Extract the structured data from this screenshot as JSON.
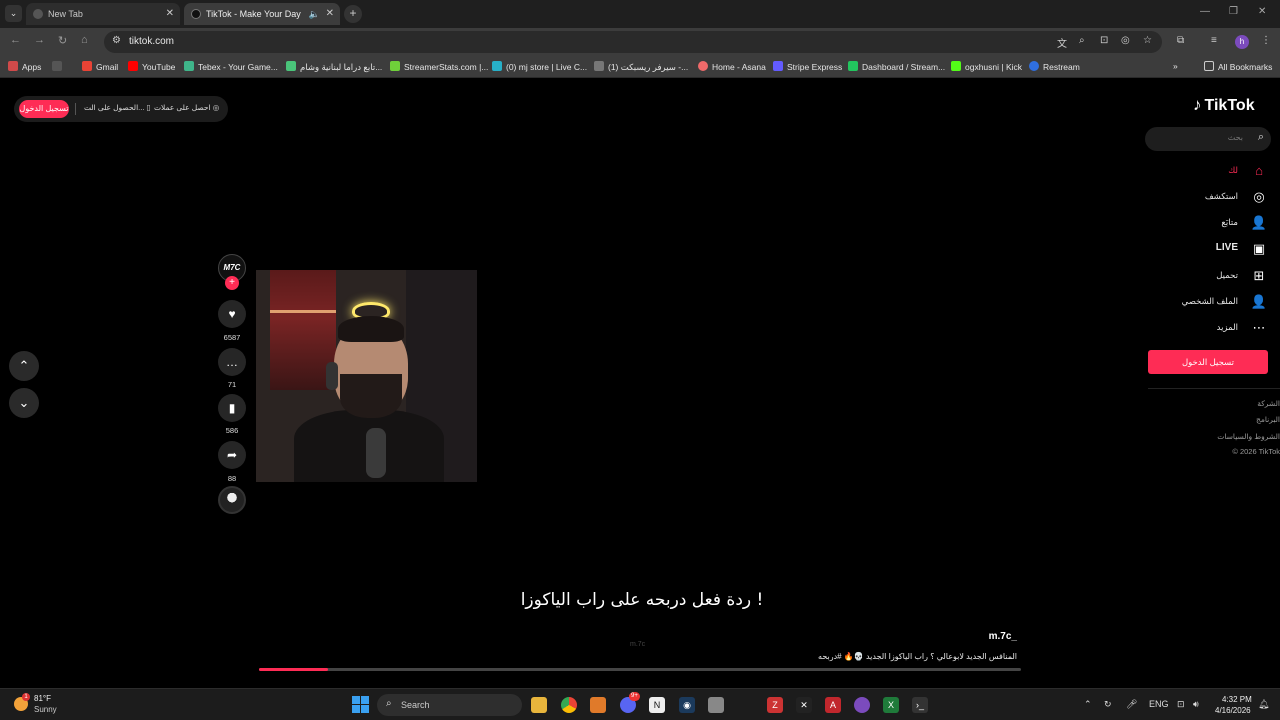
{
  "browser": {
    "tabs": [
      {
        "title": "New Tab",
        "active": false
      },
      {
        "title": "TikTok - Make Your Day",
        "active": true
      }
    ],
    "url": "tiktok.com",
    "profile_initial": "h",
    "bookmarks": [
      {
        "label": "Apps",
        "color": "#e04848"
      },
      {
        "label": "Gmail",
        "color": "#ea4335"
      },
      {
        "label": "YouTube",
        "color": "#ff0000"
      },
      {
        "label": "Tebex - Your Game...",
        "color": "#3fb58a"
      },
      {
        "label": "تابع دراما لبنانية وشام...",
        "color": "#4ac47a"
      },
      {
        "label": "StreamerStats.com |...",
        "color": "#6fd03a"
      },
      {
        "label": "(0) mj store | Live C...",
        "color": "#27b0c8"
      },
      {
        "label": "(1) سيرفر ريسبكت -...",
        "color": "#777777"
      },
      {
        "label": "Home - Asana",
        "color": "#f06a6a"
      },
      {
        "label": "Stripe Express",
        "color": "#635bff"
      },
      {
        "label": "Dashboard / Stream...",
        "color": "#22c55e"
      },
      {
        "label": "ogxhusni | Kick",
        "color": "#53fc18"
      },
      {
        "label": "Restream",
        "color": "#2f6fe0"
      }
    ],
    "all_bookmarks": "All Bookmarks"
  },
  "tiktok": {
    "logo": "TikTok",
    "topbar": {
      "login": "تسجيل الدخول",
      "get_app": "الحصول على الت...",
      "get_coins": "احصل على عملات"
    },
    "search_placeholder": "بحث",
    "nav": [
      {
        "label": "لك",
        "icon": "home-icon",
        "glyph": "⌂"
      },
      {
        "label": "استكشف",
        "icon": "compass-icon",
        "glyph": "◎"
      },
      {
        "label": "متابَع",
        "icon": "following-icon",
        "glyph": "👤"
      },
      {
        "label": "LIVE",
        "icon": "live-icon",
        "glyph": "▣"
      },
      {
        "label": "تحميل",
        "icon": "upload-icon",
        "glyph": "⊞"
      },
      {
        "label": "الملف الشخصي",
        "icon": "profile-icon",
        "glyph": "👤"
      },
      {
        "label": "المزيد",
        "icon": "more-icon",
        "glyph": "⋯"
      }
    ],
    "side_login": "تسجيل الدخول",
    "footer": [
      "الشركة",
      "البرنامج",
      "الشروط والسياسات",
      "© 2026 TikTok"
    ],
    "video": {
      "creator_avatar": "M7C",
      "likes": "6587",
      "comments": "71",
      "saves": "586",
      "shares": "88",
      "caption": "ردة فعل دربحه على راب الياكوزا !",
      "watermark": "m.7c",
      "author": "m.7c_",
      "description": "المنافس الجديد لابوعالي ؟ راب الياكوزا الجديد 💀🔥 #دربحه",
      "progress": 0.09
    },
    "accent_color": "#fe2c55"
  },
  "taskbar": {
    "weather_temp": "81°F",
    "weather_cond": "Sunny",
    "weather_badge": "1",
    "search_placeholder": "Search",
    "discord_badge": "9+",
    "language": "ENG",
    "time": "4:32 PM",
    "date": "4/16/2026"
  }
}
